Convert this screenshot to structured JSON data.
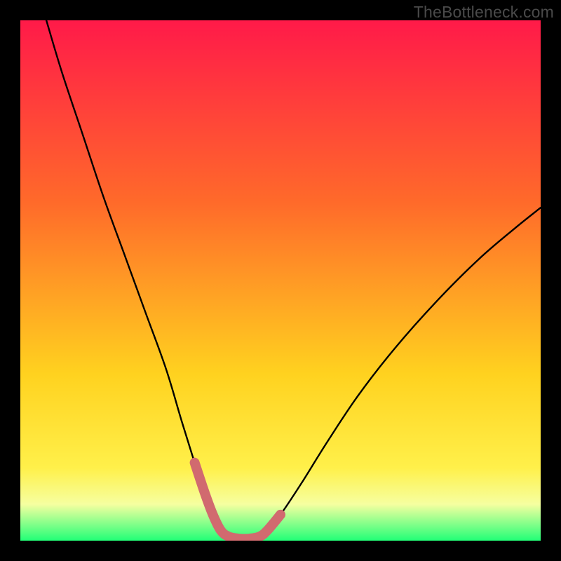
{
  "watermark": "TheBottleneck.com",
  "colors": {
    "bg": "#000000",
    "gradient_top": "#ff1a49",
    "gradient_mid1": "#ff6a2a",
    "gradient_mid2": "#ffd21f",
    "gradient_mid3": "#fff04a",
    "gradient_mid4": "#f6ffa0",
    "gradient_bottom": "#22ff77",
    "curve": "#000000",
    "highlight": "#d16a6f"
  },
  "chart_data": {
    "type": "line",
    "title": "",
    "xlabel": "",
    "ylabel": "",
    "xlim": [
      0,
      100
    ],
    "ylim": [
      0,
      100
    ],
    "series": [
      {
        "name": "left-branch",
        "x": [
          5,
          8,
          12,
          16,
          20,
          24,
          28,
          31,
          33.5,
          35.5,
          37,
          38.5
        ],
        "y": [
          100,
          90,
          78,
          66,
          55,
          44,
          33,
          23,
          15,
          9,
          5,
          2
        ]
      },
      {
        "name": "trough",
        "x": [
          38.5,
          40,
          42,
          44,
          46,
          47.5
        ],
        "y": [
          2,
          0.8,
          0.4,
          0.4,
          0.8,
          2
        ]
      },
      {
        "name": "right-branch",
        "x": [
          47.5,
          50,
          54,
          59,
          65,
          72,
          80,
          88,
          95,
          100
        ],
        "y": [
          2,
          5,
          11,
          19,
          28,
          37,
          46,
          54,
          60,
          64
        ]
      }
    ],
    "highlight_segments": [
      {
        "branch": "left-branch",
        "x_start": 33.5,
        "x_end": 38.5
      },
      {
        "branch": "trough",
        "x_start": 38.5,
        "x_end": 47.5
      },
      {
        "branch": "right-branch",
        "x_start": 47.5,
        "x_end": 50.5
      }
    ],
    "background_bands": [
      {
        "y_from": 100,
        "y_to": 10,
        "color_top": "#ff1a49",
        "color_bottom": "#fff04a"
      },
      {
        "y_from": 10,
        "y_to": 4,
        "color_top": "#fff04a",
        "color_bottom": "#f6ffa0"
      },
      {
        "y_from": 4,
        "y_to": 0,
        "color_top": "#d8ff9a",
        "color_bottom": "#22ff77"
      }
    ]
  }
}
